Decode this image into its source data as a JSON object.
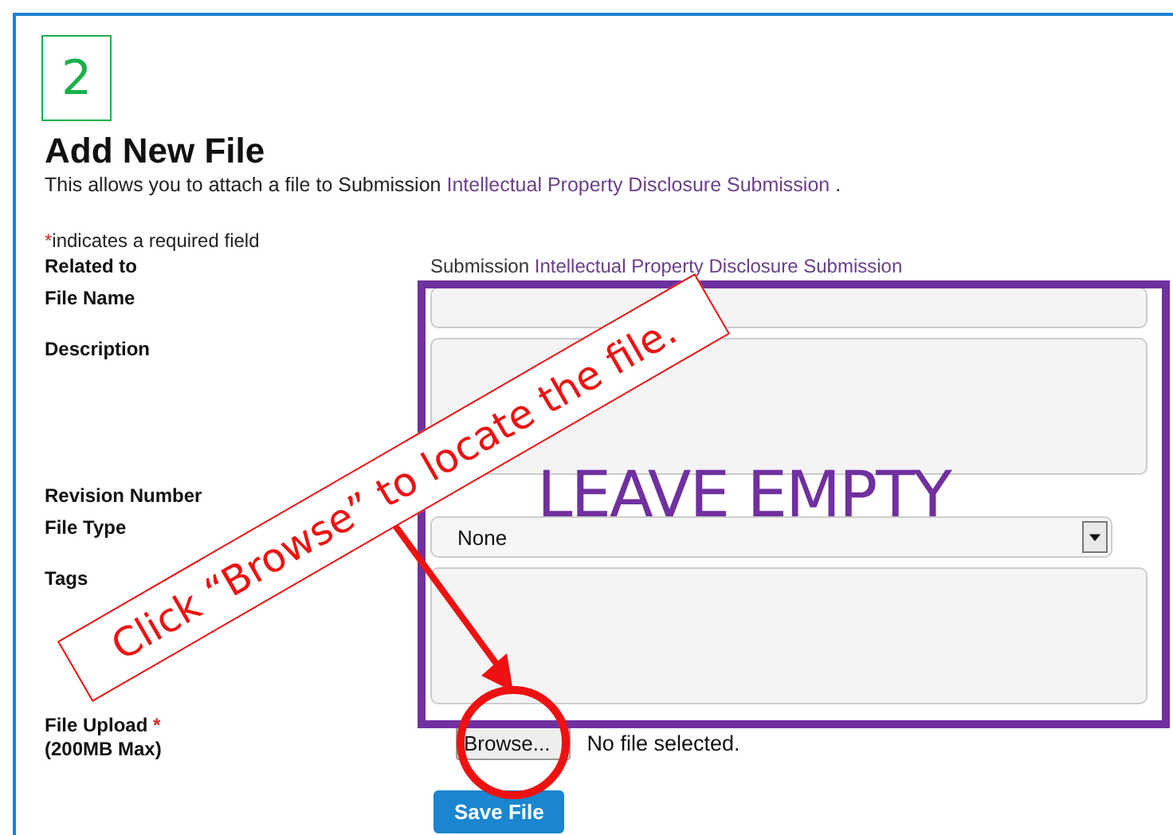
{
  "step": "2",
  "title": "Add New File",
  "intro": {
    "prefix": "This allows you to attach a file to Submission",
    "link": "Intellectual Property Disclosure Submission",
    "suffix": "."
  },
  "required_note": {
    "mark": "*",
    "text": "indicates a required field"
  },
  "fields": [
    {
      "label": "Related to",
      "kind": "text",
      "prefix": "Submission",
      "link": "Intellectual Property Disclosure Submission"
    },
    {
      "label": "File Name",
      "kind": "input"
    },
    {
      "label": "Description",
      "kind": "textarea"
    },
    {
      "label": "Revision Number",
      "kind": "blank"
    },
    {
      "label": "File Type",
      "kind": "select",
      "value": "None"
    },
    {
      "label": "Tags",
      "kind": "textarea"
    },
    {
      "label": "File Upload",
      "kind": "file",
      "required": true,
      "note": "(200MB Max)",
      "button": "Browse...",
      "status": "No file selected."
    }
  ],
  "save_button": "Save File",
  "annotations": {
    "leave_empty": "LEAVE EMPTY",
    "callout": "Click “Browse” to locate the file."
  }
}
